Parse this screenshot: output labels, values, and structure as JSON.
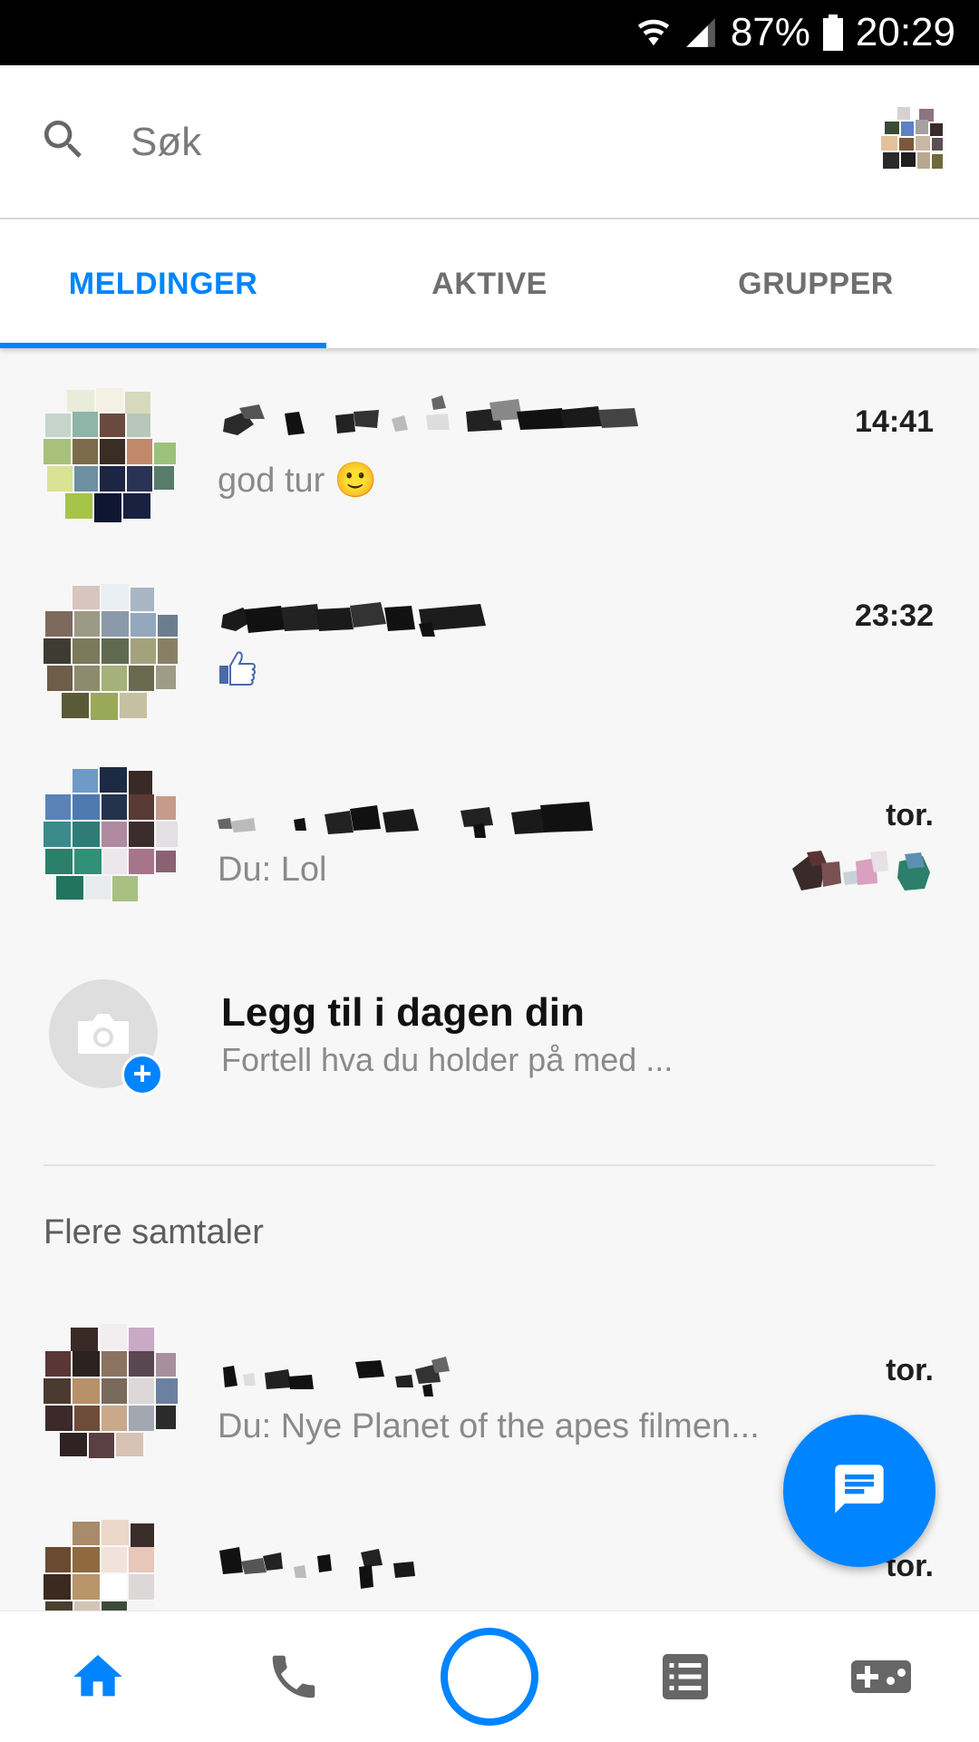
{
  "status_bar": {
    "battery": "87%",
    "time": "20:29"
  },
  "search": {
    "placeholder": "Søk"
  },
  "tabs": [
    {
      "label": "MELDINGER",
      "active": true
    },
    {
      "label": "AKTIVE",
      "active": false
    },
    {
      "label": "GRUPPER",
      "active": false
    }
  ],
  "conversations": [
    {
      "time": "14:41",
      "snippet": "god tur 🙂"
    },
    {
      "time": "23:32",
      "snippet": ""
    },
    {
      "time": "tor.",
      "snippet": "Du: Lol"
    }
  ],
  "add_to_day": {
    "title": "Legg til i dagen din",
    "subtitle": "Fortell hva du holder på med ..."
  },
  "more_section": {
    "header": "Flere samtaler",
    "items": [
      {
        "time": "tor.",
        "snippet": "Du: Nye Planet of the apes filmen..."
      },
      {
        "time": "tor.",
        "snippet": ""
      }
    ]
  },
  "bottom_nav": [
    "home-icon",
    "phone-icon",
    "camera-icon",
    "list-icon",
    "games-icon"
  ],
  "colors": {
    "accent": "#0084ff",
    "status_bar": "#000000"
  }
}
